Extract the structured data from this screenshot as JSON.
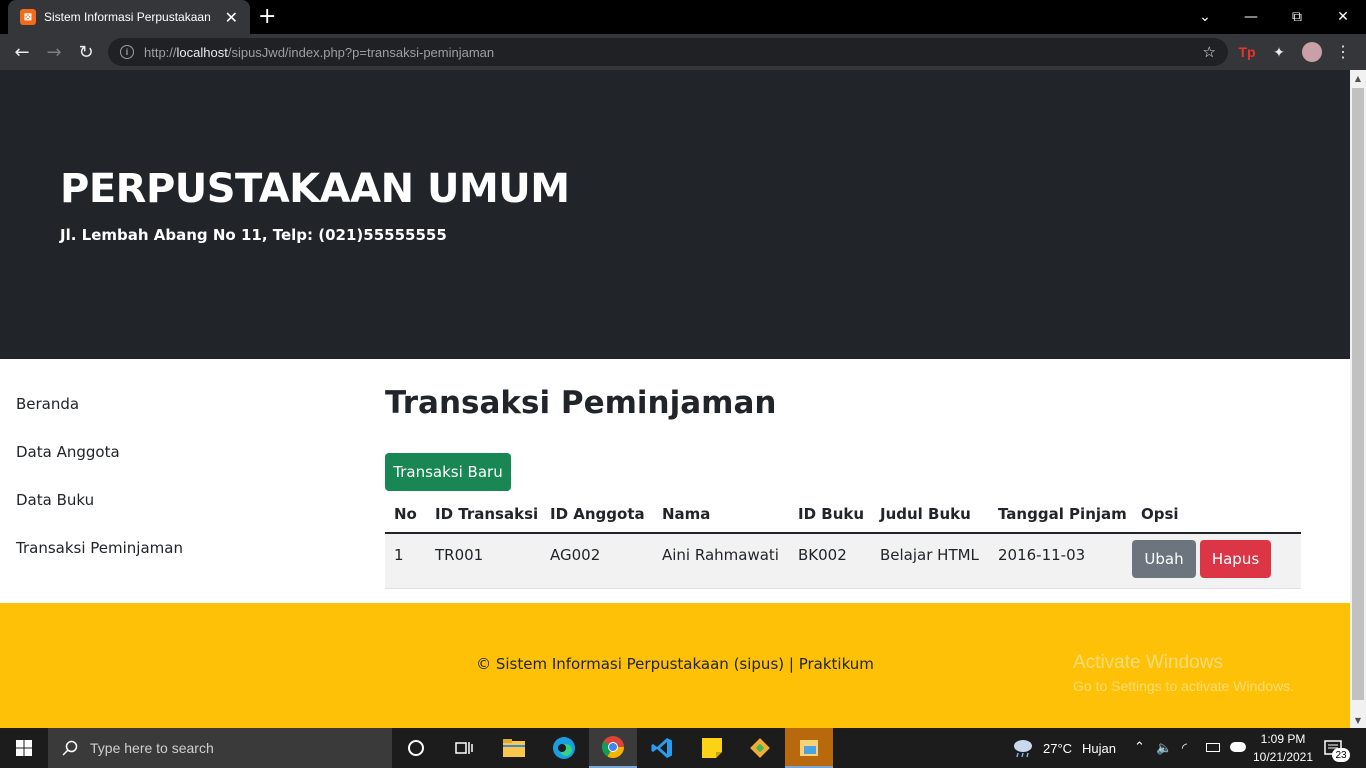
{
  "browser": {
    "tab_title": "Sistem Informasi Perpustakaan",
    "tab_favicon_text": "⊠",
    "tab_close": "✕",
    "new_tab": "+",
    "url_host": "localhost",
    "url_prefix": "http://",
    "url_path": "/sipusJwd/index.php?p=transaksi-peminjaman",
    "win_min": "—",
    "win_restore": "⧉",
    "win_close": "✕",
    "win_chevron": "⌄",
    "back": "←",
    "forward": "→",
    "reload": "↻",
    "info_glyph": "i",
    "star": "☆",
    "ext_tp": "Tp",
    "ext_puzzle": "✦",
    "menu": "⋮"
  },
  "site": {
    "title": "PERPUSTAKAAN UMUM",
    "subtitle": "Jl. Lembah Abang No 11, Telp: (021)55555555"
  },
  "sidebar": {
    "items": [
      {
        "label": "Beranda"
      },
      {
        "label": "Data Anggota"
      },
      {
        "label": "Data Buku"
      },
      {
        "label": "Transaksi Peminjaman"
      }
    ]
  },
  "main": {
    "heading": "Transaksi Peminjaman",
    "new_button": "Transaksi Baru",
    "table": {
      "headers": [
        "No",
        "ID Transaksi",
        "ID Anggota",
        "Nama",
        "ID Buku",
        "Judul Buku",
        "Tanggal Pinjam",
        "Opsi"
      ],
      "rows": [
        {
          "no": "1",
          "id_transaksi": "TR001",
          "id_anggota": "AG002",
          "nama": "Aini Rahmawati",
          "id_buku": "BK002",
          "judul_buku": "Belajar HTML",
          "tanggal_pinjam": "2016-11-03",
          "edit_label": "Ubah",
          "delete_label": "Hapus"
        }
      ]
    }
  },
  "footer": {
    "text": "© Sistem Informasi Perpustakaan (sipus) | Praktikum",
    "watermark_title": "Activate Windows",
    "watermark_sub": "Go to Settings to activate Windows."
  },
  "taskbar": {
    "search_placeholder": "Type here to search",
    "weather_temp": "27°C",
    "weather_text": "Hujan",
    "time": "1:09 PM",
    "date": "10/21/2021",
    "notification_count": "23"
  },
  "colors": {
    "hero_bg": "#212529",
    "success": "#198754",
    "secondary": "#6c757d",
    "danger": "#dc3545",
    "warning": "#ffc107"
  }
}
